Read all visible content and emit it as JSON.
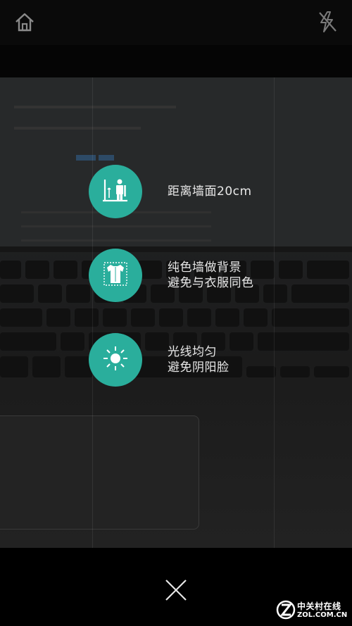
{
  "header": {
    "home_icon": "home-icon",
    "flash_icon": "flash-off-icon"
  },
  "tips": [
    {
      "icon": "distance-wall-icon",
      "lines": [
        "距离墙面20cm"
      ]
    },
    {
      "icon": "shirt-icon",
      "lines": [
        "纯色墙做背景",
        "避免与衣服同色"
      ]
    },
    {
      "icon": "sun-light-icon",
      "lines": [
        "光线均匀",
        "避免阴阳脸"
      ]
    }
  ],
  "footer": {
    "close_icon": "close-icon"
  },
  "watermark": {
    "cn": "中关村在线",
    "en": "ZOL.COM.CN"
  },
  "colors": {
    "accent": "#2aae9c",
    "icon_gray": "#8a8a8a"
  }
}
